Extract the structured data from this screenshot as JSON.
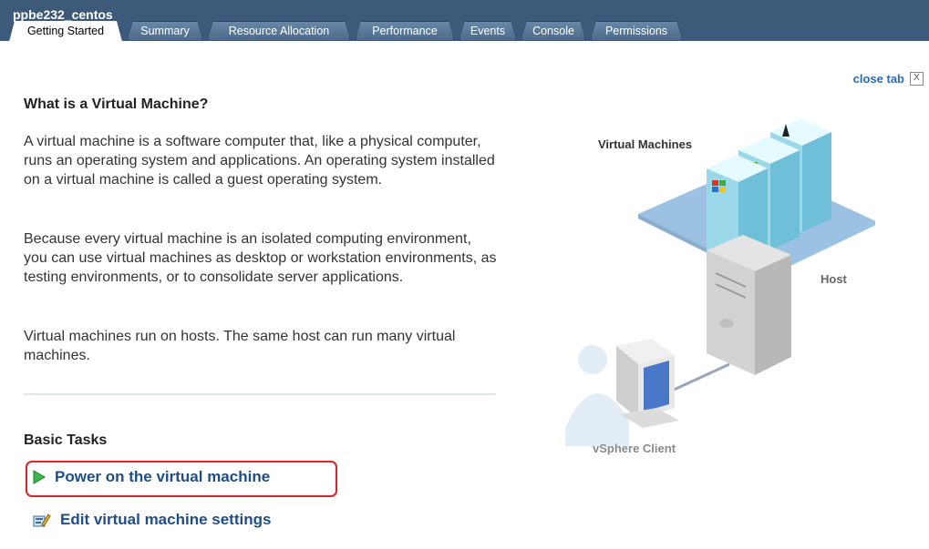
{
  "window": {
    "title": "ppbe232_centos"
  },
  "tabs": [
    {
      "label": "Getting Started",
      "active": true
    },
    {
      "label": "Summary"
    },
    {
      "label": "Resource Allocation"
    },
    {
      "label": "Performance"
    },
    {
      "label": "Events"
    },
    {
      "label": "Console"
    },
    {
      "label": "Permissions"
    }
  ],
  "close_tab": {
    "label": "close tab",
    "box": "X"
  },
  "main": {
    "heading": "What is a Virtual Machine?",
    "para1": "A virtual machine is a software computer that, like a physical computer, runs an operating system and applications. An operating system installed on a virtual machine is called a guest operating system.",
    "para2": "Because every virtual machine is an isolated computing environment, you can use virtual machines as desktop or workstation environments, as testing environments, or to consolidate server applications.",
    "para3": "Virtual machines run on hosts. The same host can run many virtual machines."
  },
  "basic_tasks": {
    "heading": "Basic Tasks",
    "power_on": "Power on the virtual machine",
    "edit_settings": "Edit virtual machine settings"
  },
  "diagram": {
    "vm_label": "Virtual Machines",
    "host_label": "Host",
    "client_label": "vSphere Client"
  },
  "colors": {
    "titlebar": "#3d5a7a",
    "link": "#1f4d86",
    "highlight": "#e0202a"
  }
}
